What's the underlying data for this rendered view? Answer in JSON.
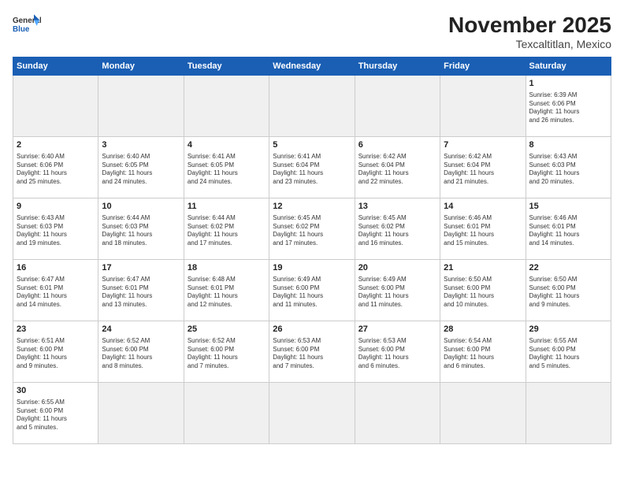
{
  "header": {
    "logo_line1": "General",
    "logo_line2": "Blue",
    "title": "November 2025",
    "subtitle": "Texcaltitlan, Mexico"
  },
  "weekdays": [
    "Sunday",
    "Monday",
    "Tuesday",
    "Wednesday",
    "Thursday",
    "Friday",
    "Saturday"
  ],
  "weeks": [
    [
      {
        "day": "",
        "info": ""
      },
      {
        "day": "",
        "info": ""
      },
      {
        "day": "",
        "info": ""
      },
      {
        "day": "",
        "info": ""
      },
      {
        "day": "",
        "info": ""
      },
      {
        "day": "",
        "info": ""
      },
      {
        "day": "1",
        "info": "Sunrise: 6:39 AM\nSunset: 6:06 PM\nDaylight: 11 hours\nand 26 minutes."
      }
    ],
    [
      {
        "day": "2",
        "info": "Sunrise: 6:40 AM\nSunset: 6:06 PM\nDaylight: 11 hours\nand 25 minutes."
      },
      {
        "day": "3",
        "info": "Sunrise: 6:40 AM\nSunset: 6:05 PM\nDaylight: 11 hours\nand 24 minutes."
      },
      {
        "day": "4",
        "info": "Sunrise: 6:41 AM\nSunset: 6:05 PM\nDaylight: 11 hours\nand 24 minutes."
      },
      {
        "day": "5",
        "info": "Sunrise: 6:41 AM\nSunset: 6:04 PM\nDaylight: 11 hours\nand 23 minutes."
      },
      {
        "day": "6",
        "info": "Sunrise: 6:42 AM\nSunset: 6:04 PM\nDaylight: 11 hours\nand 22 minutes."
      },
      {
        "day": "7",
        "info": "Sunrise: 6:42 AM\nSunset: 6:04 PM\nDaylight: 11 hours\nand 21 minutes."
      },
      {
        "day": "8",
        "info": "Sunrise: 6:43 AM\nSunset: 6:03 PM\nDaylight: 11 hours\nand 20 minutes."
      }
    ],
    [
      {
        "day": "9",
        "info": "Sunrise: 6:43 AM\nSunset: 6:03 PM\nDaylight: 11 hours\nand 19 minutes."
      },
      {
        "day": "10",
        "info": "Sunrise: 6:44 AM\nSunset: 6:03 PM\nDaylight: 11 hours\nand 18 minutes."
      },
      {
        "day": "11",
        "info": "Sunrise: 6:44 AM\nSunset: 6:02 PM\nDaylight: 11 hours\nand 17 minutes."
      },
      {
        "day": "12",
        "info": "Sunrise: 6:45 AM\nSunset: 6:02 PM\nDaylight: 11 hours\nand 17 minutes."
      },
      {
        "day": "13",
        "info": "Sunrise: 6:45 AM\nSunset: 6:02 PM\nDaylight: 11 hours\nand 16 minutes."
      },
      {
        "day": "14",
        "info": "Sunrise: 6:46 AM\nSunset: 6:01 PM\nDaylight: 11 hours\nand 15 minutes."
      },
      {
        "day": "15",
        "info": "Sunrise: 6:46 AM\nSunset: 6:01 PM\nDaylight: 11 hours\nand 14 minutes."
      }
    ],
    [
      {
        "day": "16",
        "info": "Sunrise: 6:47 AM\nSunset: 6:01 PM\nDaylight: 11 hours\nand 14 minutes."
      },
      {
        "day": "17",
        "info": "Sunrise: 6:47 AM\nSunset: 6:01 PM\nDaylight: 11 hours\nand 13 minutes."
      },
      {
        "day": "18",
        "info": "Sunrise: 6:48 AM\nSunset: 6:01 PM\nDaylight: 11 hours\nand 12 minutes."
      },
      {
        "day": "19",
        "info": "Sunrise: 6:49 AM\nSunset: 6:00 PM\nDaylight: 11 hours\nand 11 minutes."
      },
      {
        "day": "20",
        "info": "Sunrise: 6:49 AM\nSunset: 6:00 PM\nDaylight: 11 hours\nand 11 minutes."
      },
      {
        "day": "21",
        "info": "Sunrise: 6:50 AM\nSunset: 6:00 PM\nDaylight: 11 hours\nand 10 minutes."
      },
      {
        "day": "22",
        "info": "Sunrise: 6:50 AM\nSunset: 6:00 PM\nDaylight: 11 hours\nand 9 minutes."
      }
    ],
    [
      {
        "day": "23",
        "info": "Sunrise: 6:51 AM\nSunset: 6:00 PM\nDaylight: 11 hours\nand 9 minutes."
      },
      {
        "day": "24",
        "info": "Sunrise: 6:52 AM\nSunset: 6:00 PM\nDaylight: 11 hours\nand 8 minutes."
      },
      {
        "day": "25",
        "info": "Sunrise: 6:52 AM\nSunset: 6:00 PM\nDaylight: 11 hours\nand 7 minutes."
      },
      {
        "day": "26",
        "info": "Sunrise: 6:53 AM\nSunset: 6:00 PM\nDaylight: 11 hours\nand 7 minutes."
      },
      {
        "day": "27",
        "info": "Sunrise: 6:53 AM\nSunset: 6:00 PM\nDaylight: 11 hours\nand 6 minutes."
      },
      {
        "day": "28",
        "info": "Sunrise: 6:54 AM\nSunset: 6:00 PM\nDaylight: 11 hours\nand 6 minutes."
      },
      {
        "day": "29",
        "info": "Sunrise: 6:55 AM\nSunset: 6:00 PM\nDaylight: 11 hours\nand 5 minutes."
      }
    ],
    [
      {
        "day": "30",
        "info": "Sunrise: 6:55 AM\nSunset: 6:00 PM\nDaylight: 11 hours\nand 5 minutes."
      },
      {
        "day": "",
        "info": ""
      },
      {
        "day": "",
        "info": ""
      },
      {
        "day": "",
        "info": ""
      },
      {
        "day": "",
        "info": ""
      },
      {
        "day": "",
        "info": ""
      },
      {
        "day": "",
        "info": ""
      }
    ]
  ]
}
